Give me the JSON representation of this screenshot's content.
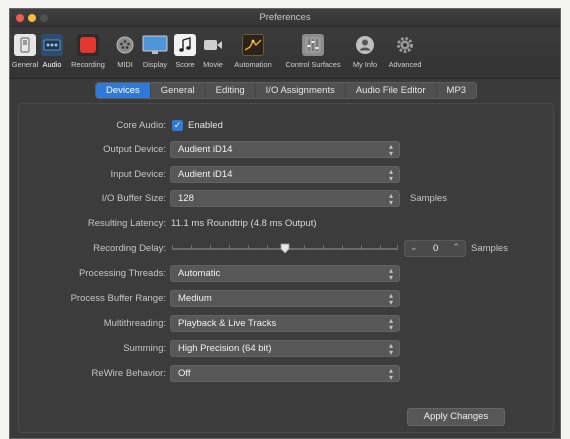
{
  "window": {
    "title": "Preferences"
  },
  "toolbar": {
    "items": [
      {
        "label": "General",
        "icon": "switch-icon",
        "color": "#d8d8d8"
      },
      {
        "label": "Audio",
        "icon": "audio-interface-icon",
        "color": "#2b4d6f"
      },
      {
        "label": "Recording",
        "icon": "record-icon",
        "color": "#e3372d"
      },
      {
        "label": "MIDI",
        "icon": "midi-port-icon",
        "color": "#8a8a8a"
      },
      {
        "label": "Display",
        "icon": "display-icon",
        "color": "#4f95d8"
      },
      {
        "label": "Score",
        "icon": "music-note-icon",
        "color": "#f2f2f2"
      },
      {
        "label": "Movie",
        "icon": "movie-camera-icon",
        "color": "#cfcfcf"
      },
      {
        "label": "Automation",
        "icon": "automation-curve-icon",
        "color": "#5a4a2f"
      },
      {
        "label": "Control Surfaces",
        "icon": "mixer-icon",
        "color": "#8c8c8c"
      },
      {
        "label": "My Info",
        "icon": "user-icon",
        "color": "#bfbfbf"
      },
      {
        "label": "Advanced",
        "icon": "gear-icon",
        "color": "#9a9a9a"
      }
    ],
    "active": "Audio"
  },
  "tabs": {
    "items": [
      "Devices",
      "General",
      "Editing",
      "I/O Assignments",
      "Audio File Editor",
      "MP3"
    ],
    "active": "Devices"
  },
  "devices": {
    "core_audio": {
      "label": "Core Audio:",
      "checkbox_label": "Enabled",
      "checked": true
    },
    "output_device": {
      "label": "Output Device:",
      "value": "Audient iD14"
    },
    "input_device": {
      "label": "Input Device:",
      "value": "Audient iD14"
    },
    "io_buffer_size": {
      "label": "I/O Buffer Size:",
      "value": "128",
      "unit": "Samples"
    },
    "resulting_latency": {
      "label": "Resulting Latency:",
      "value": "11.1 ms Roundtrip (4.8 ms Output)"
    },
    "recording_delay": {
      "label": "Recording Delay:",
      "value": "0",
      "unit": "Samples",
      "slider_level": 0.5
    },
    "processing_threads": {
      "label": "Processing Threads:",
      "value": "Automatic"
    },
    "process_buffer_range": {
      "label": "Process Buffer Range:",
      "value": "Medium"
    },
    "multithreading": {
      "label": "Multithreading:",
      "value": "Playback & Live Tracks"
    },
    "summing": {
      "label": "Summing:",
      "value": "High Precision (64 bit)"
    },
    "rewire_behavior": {
      "label": "ReWire Behavior:",
      "value": "Off"
    }
  },
  "apply_button": {
    "label": "Apply Changes"
  },
  "colors": {
    "accent": "#2f79d9",
    "background": "#3a3a3a"
  }
}
